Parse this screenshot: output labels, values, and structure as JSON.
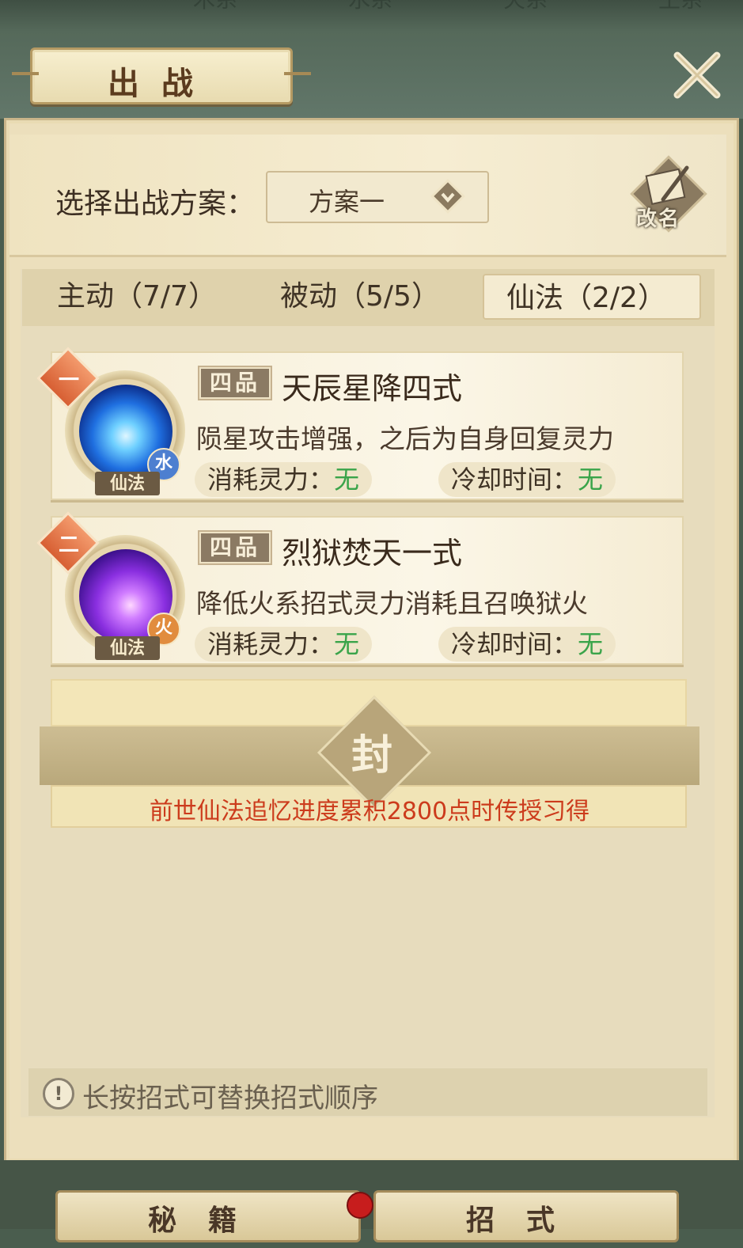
{
  "top_tabs": [
    "木系",
    "水系",
    "火系",
    "土系"
  ],
  "header": {
    "title": "出战"
  },
  "plan": {
    "label": "选择出战方案：",
    "selected": "方案一",
    "rename_label": "改名"
  },
  "tabs": [
    {
      "label": "主动（7/7）",
      "active": false
    },
    {
      "label": "被动（5/5）",
      "active": false
    },
    {
      "label": "仙法（2/2）",
      "active": true
    }
  ],
  "skills": [
    {
      "slot": "一",
      "grade": "四品",
      "name": "天辰星降四式",
      "description": "陨星攻击增强，之后为自身回复灵力",
      "element": "水",
      "type": "仙法",
      "cost_label": "消耗灵力：",
      "cost_value": "无",
      "cooldown_label": "冷却时间：",
      "cooldown_value": "无"
    },
    {
      "slot": "二",
      "grade": "四品",
      "name": "烈狱焚天一式",
      "description": "降低火系招式灵力消耗且召唤狱火",
      "element": "火",
      "type": "仙法",
      "cost_label": "消耗灵力：",
      "cost_value": "无",
      "cooldown_label": "冷却时间：",
      "cooldown_value": "无"
    }
  ],
  "locked_slot": {
    "seal": "封",
    "hint": "前世仙法追忆进度累积2800点时传授习得"
  },
  "footer_hint": "长按招式可替换招式顺序",
  "bottom_tabs": [
    "秘籍",
    "招式"
  ],
  "colors": {
    "value_green": "#3aa44a",
    "hint_red": "#cc3b1c",
    "slot_orange": "#e0743f"
  }
}
